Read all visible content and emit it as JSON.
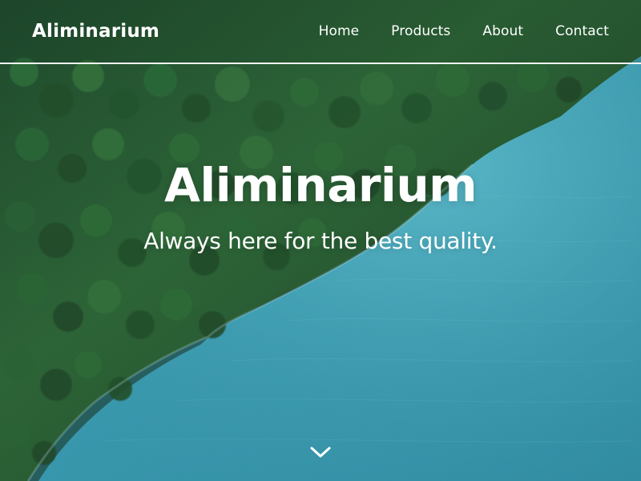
{
  "header": {
    "brand": "Aliminarium",
    "nav": [
      {
        "label": "Home"
      },
      {
        "label": "Products"
      },
      {
        "label": "About"
      },
      {
        "label": "Contact"
      }
    ]
  },
  "hero": {
    "title": "Aliminarium",
    "subtitle": "Always here for the best quality.",
    "scroll_icon": "chevron-down-icon"
  },
  "colors": {
    "text": "#ffffff",
    "forest_dark": "#173b22",
    "forest_mid": "#2f6a37",
    "water_light": "#59b8c8",
    "water_dark": "#2d8ea3"
  }
}
